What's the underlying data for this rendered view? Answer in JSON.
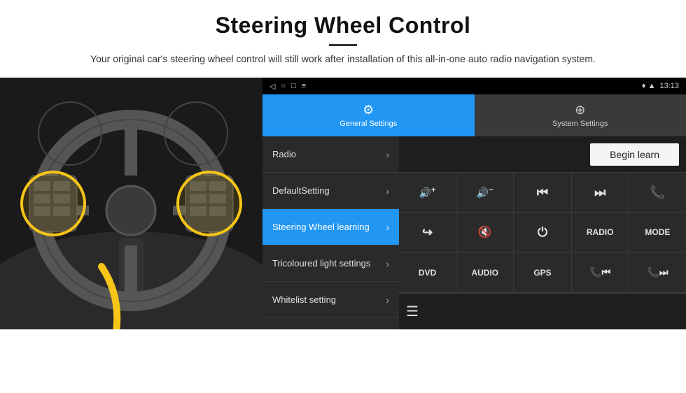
{
  "header": {
    "title": "Steering Wheel Control",
    "subtitle": "Your original car's steering wheel control will still work after installation of this all-in-one auto radio navigation system."
  },
  "status_bar": {
    "icons": [
      "◁",
      "○",
      "□",
      "≡"
    ],
    "right_text": "13:13",
    "signal_icons": "♦ ▲"
  },
  "tabs": [
    {
      "id": "general",
      "label": "General Settings",
      "icon": "⚙",
      "active": true
    },
    {
      "id": "system",
      "label": "System Settings",
      "icon": "⊕",
      "active": false
    }
  ],
  "menu_items": [
    {
      "id": "radio",
      "label": "Radio",
      "active": false
    },
    {
      "id": "default",
      "label": "DefaultSetting",
      "active": false
    },
    {
      "id": "steering",
      "label": "Steering Wheel learning",
      "active": true
    },
    {
      "id": "tricoloured",
      "label": "Tricoloured light settings",
      "active": false
    },
    {
      "id": "whitelist",
      "label": "Whitelist setting",
      "active": false
    }
  ],
  "begin_learn_label": "Begin learn",
  "control_buttons": {
    "row1": [
      {
        "id": "vol-up",
        "label": "▶+",
        "icon": "🔊+"
      },
      {
        "id": "vol-down",
        "label": "◀−",
        "icon": "🔊−"
      },
      {
        "id": "prev",
        "label": "|◀◀",
        "icon": "⏮"
      },
      {
        "id": "next",
        "label": "▶▶|",
        "icon": "⏭"
      },
      {
        "id": "phone",
        "label": "📞",
        "icon": "☎"
      }
    ],
    "row2": [
      {
        "id": "hangup",
        "label": "↩",
        "icon": "↪"
      },
      {
        "id": "mute",
        "label": "◀✕",
        "icon": "🔇"
      },
      {
        "id": "power",
        "label": "⏻",
        "icon": "⏻"
      },
      {
        "id": "radio-btn",
        "label": "RADIO",
        "icon": ""
      },
      {
        "id": "mode-btn",
        "label": "MODE",
        "icon": ""
      }
    ],
    "row3": [
      {
        "id": "dvd",
        "label": "DVD",
        "icon": ""
      },
      {
        "id": "audio",
        "label": "AUDIO",
        "icon": ""
      },
      {
        "id": "gps",
        "label": "GPS",
        "icon": ""
      },
      {
        "id": "tel-prev",
        "label": "📞◀",
        "icon": ""
      },
      {
        "id": "tel-next",
        "label": "📞▶",
        "icon": ""
      }
    ]
  },
  "colors": {
    "accent_blue": "#2196F3",
    "background_dark": "#1a1a1a",
    "menu_dark": "#2a2a2a",
    "text_light": "#e0e0e0",
    "begin_learn_bg": "#f5f5f5"
  }
}
